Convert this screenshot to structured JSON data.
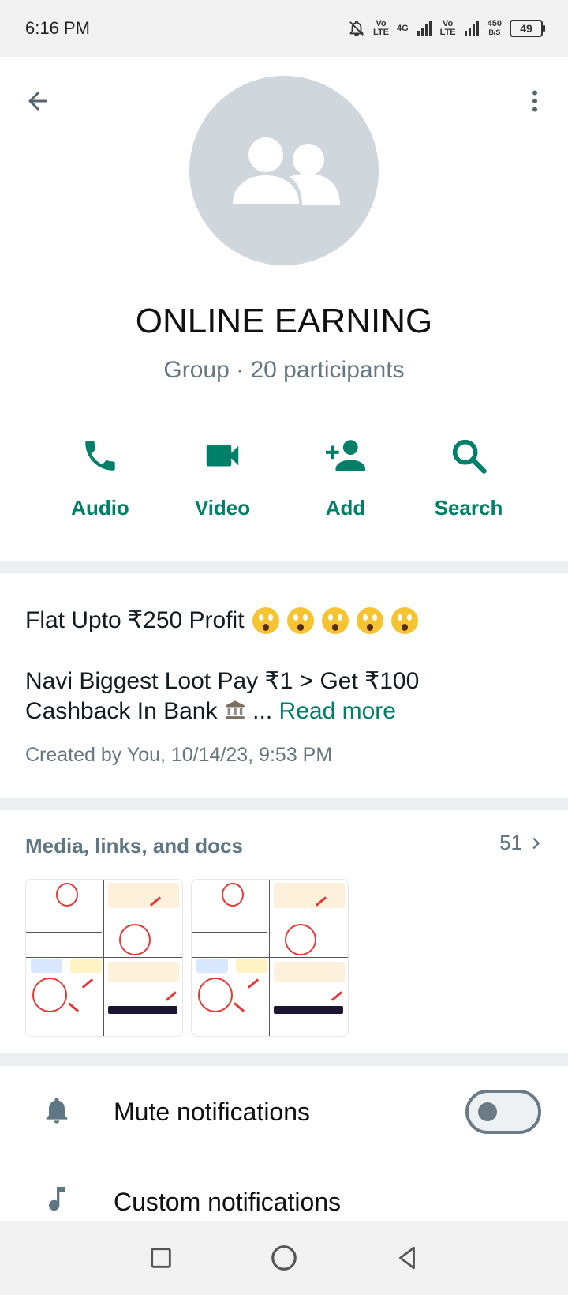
{
  "status_bar": {
    "time": "6:16 PM",
    "net1_top": "Vo",
    "net1_bottom": "LTE",
    "net2": "4G",
    "net3_top": "Vo",
    "net3_bottom": "LTE",
    "speed_value": "450",
    "speed_unit": "B/S",
    "battery": "49"
  },
  "header": {
    "back_icon": "arrow-left-icon",
    "menu_icon": "more-vert-icon",
    "avatar_icon": "group-icon",
    "group_name": "ONLINE EARNING",
    "group_info": "Group · 20 participants"
  },
  "actions": [
    {
      "label": "Audio",
      "icon": "phone-icon"
    },
    {
      "label": "Video",
      "icon": "videocam-icon"
    },
    {
      "label": "Add",
      "icon": "person-add-icon"
    },
    {
      "label": "Search",
      "icon": "search-icon"
    }
  ],
  "description": {
    "line1": "Flat Upto ₹250 Profit",
    "line2": "Navi Biggest Loot Pay ₹1 > Get ₹100",
    "line3": "Cashback In Bank",
    "ellipsis": "...",
    "read_more": "Read more",
    "created": "Created by You, 10/14/23, 9:53 PM"
  },
  "media": {
    "title": "Media, links, and docs",
    "count": "51"
  },
  "settings": {
    "mute_label": "Mute notifications",
    "mute_enabled": false,
    "custom_label": "Custom notifications"
  },
  "colors": {
    "accent": "#008069",
    "avatar_bg": "#cfd6dc",
    "secondary_text": "#667781"
  }
}
